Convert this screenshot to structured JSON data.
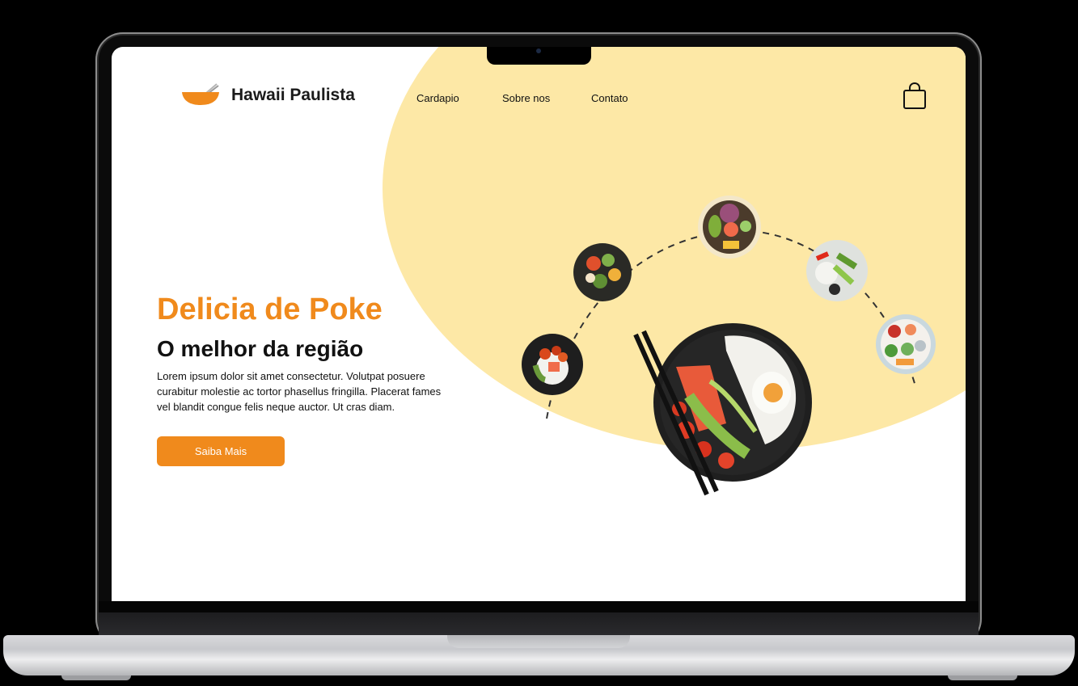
{
  "header": {
    "brand": "Hawaii Paulista",
    "nav": [
      {
        "label": "Cardapio"
      },
      {
        "label": "Sobre nos"
      },
      {
        "label": "Contato"
      }
    ]
  },
  "hero": {
    "title": "Delicia de Poke",
    "subtitle": "O melhor da região",
    "description": "Lorem ipsum dolor sit amet consectetur. Volutpat posuere curabitur molestie ac tortor phasellus fringilla. Placerat fames vel blandit congue felis neque auctor. Ut cras diam.",
    "cta_label": "Saiba Mais"
  },
  "colors": {
    "accent": "#f08a1c",
    "blob": "#fde8a6",
    "text": "#111111"
  },
  "icons": [
    "bowl-logo-icon",
    "shopping-bag-icon"
  ]
}
